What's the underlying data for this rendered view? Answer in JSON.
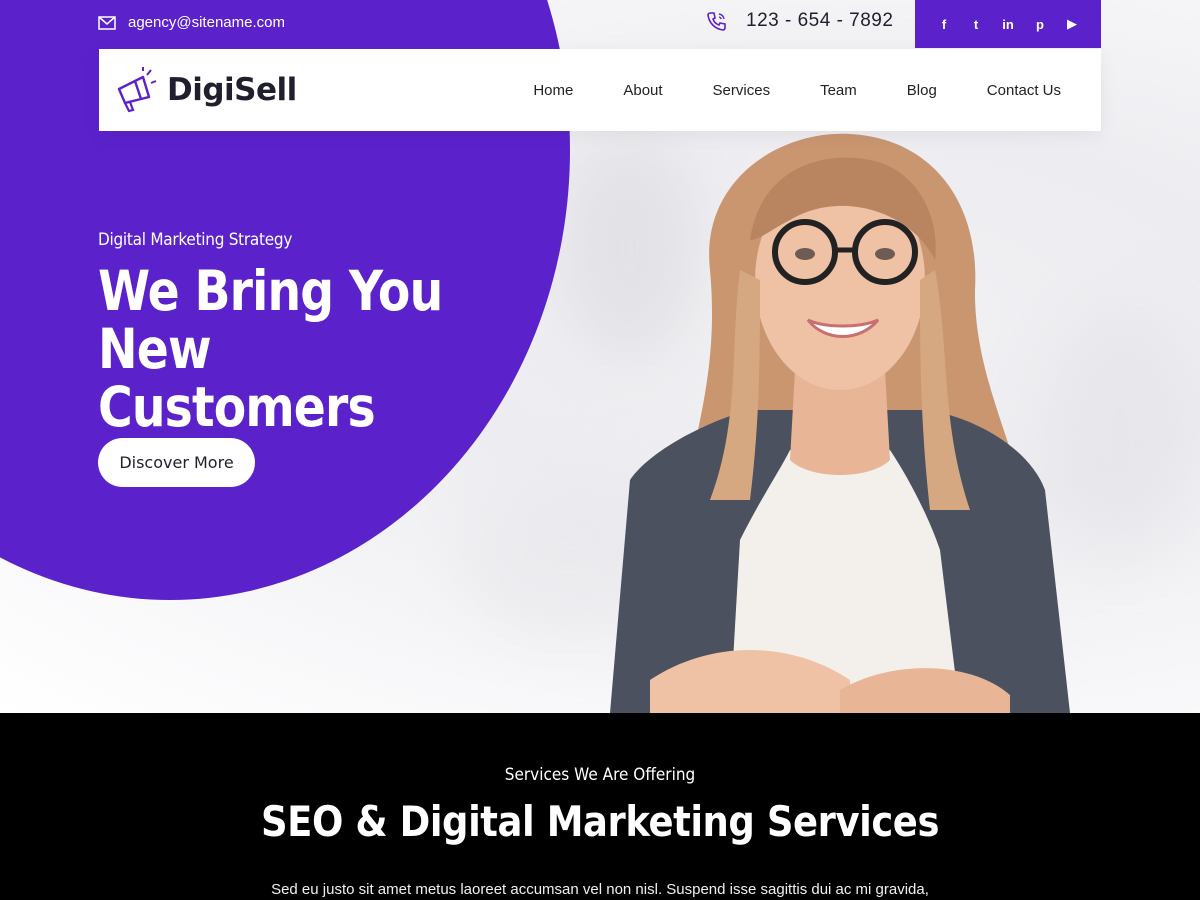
{
  "topbar": {
    "email": "agency@sitename.com",
    "phone": "123 - 654 - 7892",
    "social": [
      {
        "name": "facebook-icon",
        "glyph": "f"
      },
      {
        "name": "twitter-icon",
        "glyph": "t"
      },
      {
        "name": "linkedin-icon",
        "glyph": "in"
      },
      {
        "name": "pinterest-icon",
        "glyph": "p"
      },
      {
        "name": "youtube-icon",
        "glyph": "▶"
      }
    ]
  },
  "brand": {
    "name": "DigiSell"
  },
  "nav": {
    "items": [
      "Home",
      "About",
      "Services",
      "Team",
      "Blog",
      "Contact Us"
    ]
  },
  "hero": {
    "eyebrow": "Digital Marketing Strategy",
    "headline_line1": "We Bring You New",
    "headline_line2": "Customers",
    "cta_label": "Discover More"
  },
  "services": {
    "eyebrow": "Services We Are Offering",
    "title": "SEO & Digital Marketing Services",
    "description": "Sed eu justo sit amet metus laoreet accumsan vel non nisl. Suspend isse sagittis dui ac mi gravida,"
  },
  "colors": {
    "accent": "#5b22cb",
    "dark": "#000000",
    "text": "#1f1f2e"
  }
}
